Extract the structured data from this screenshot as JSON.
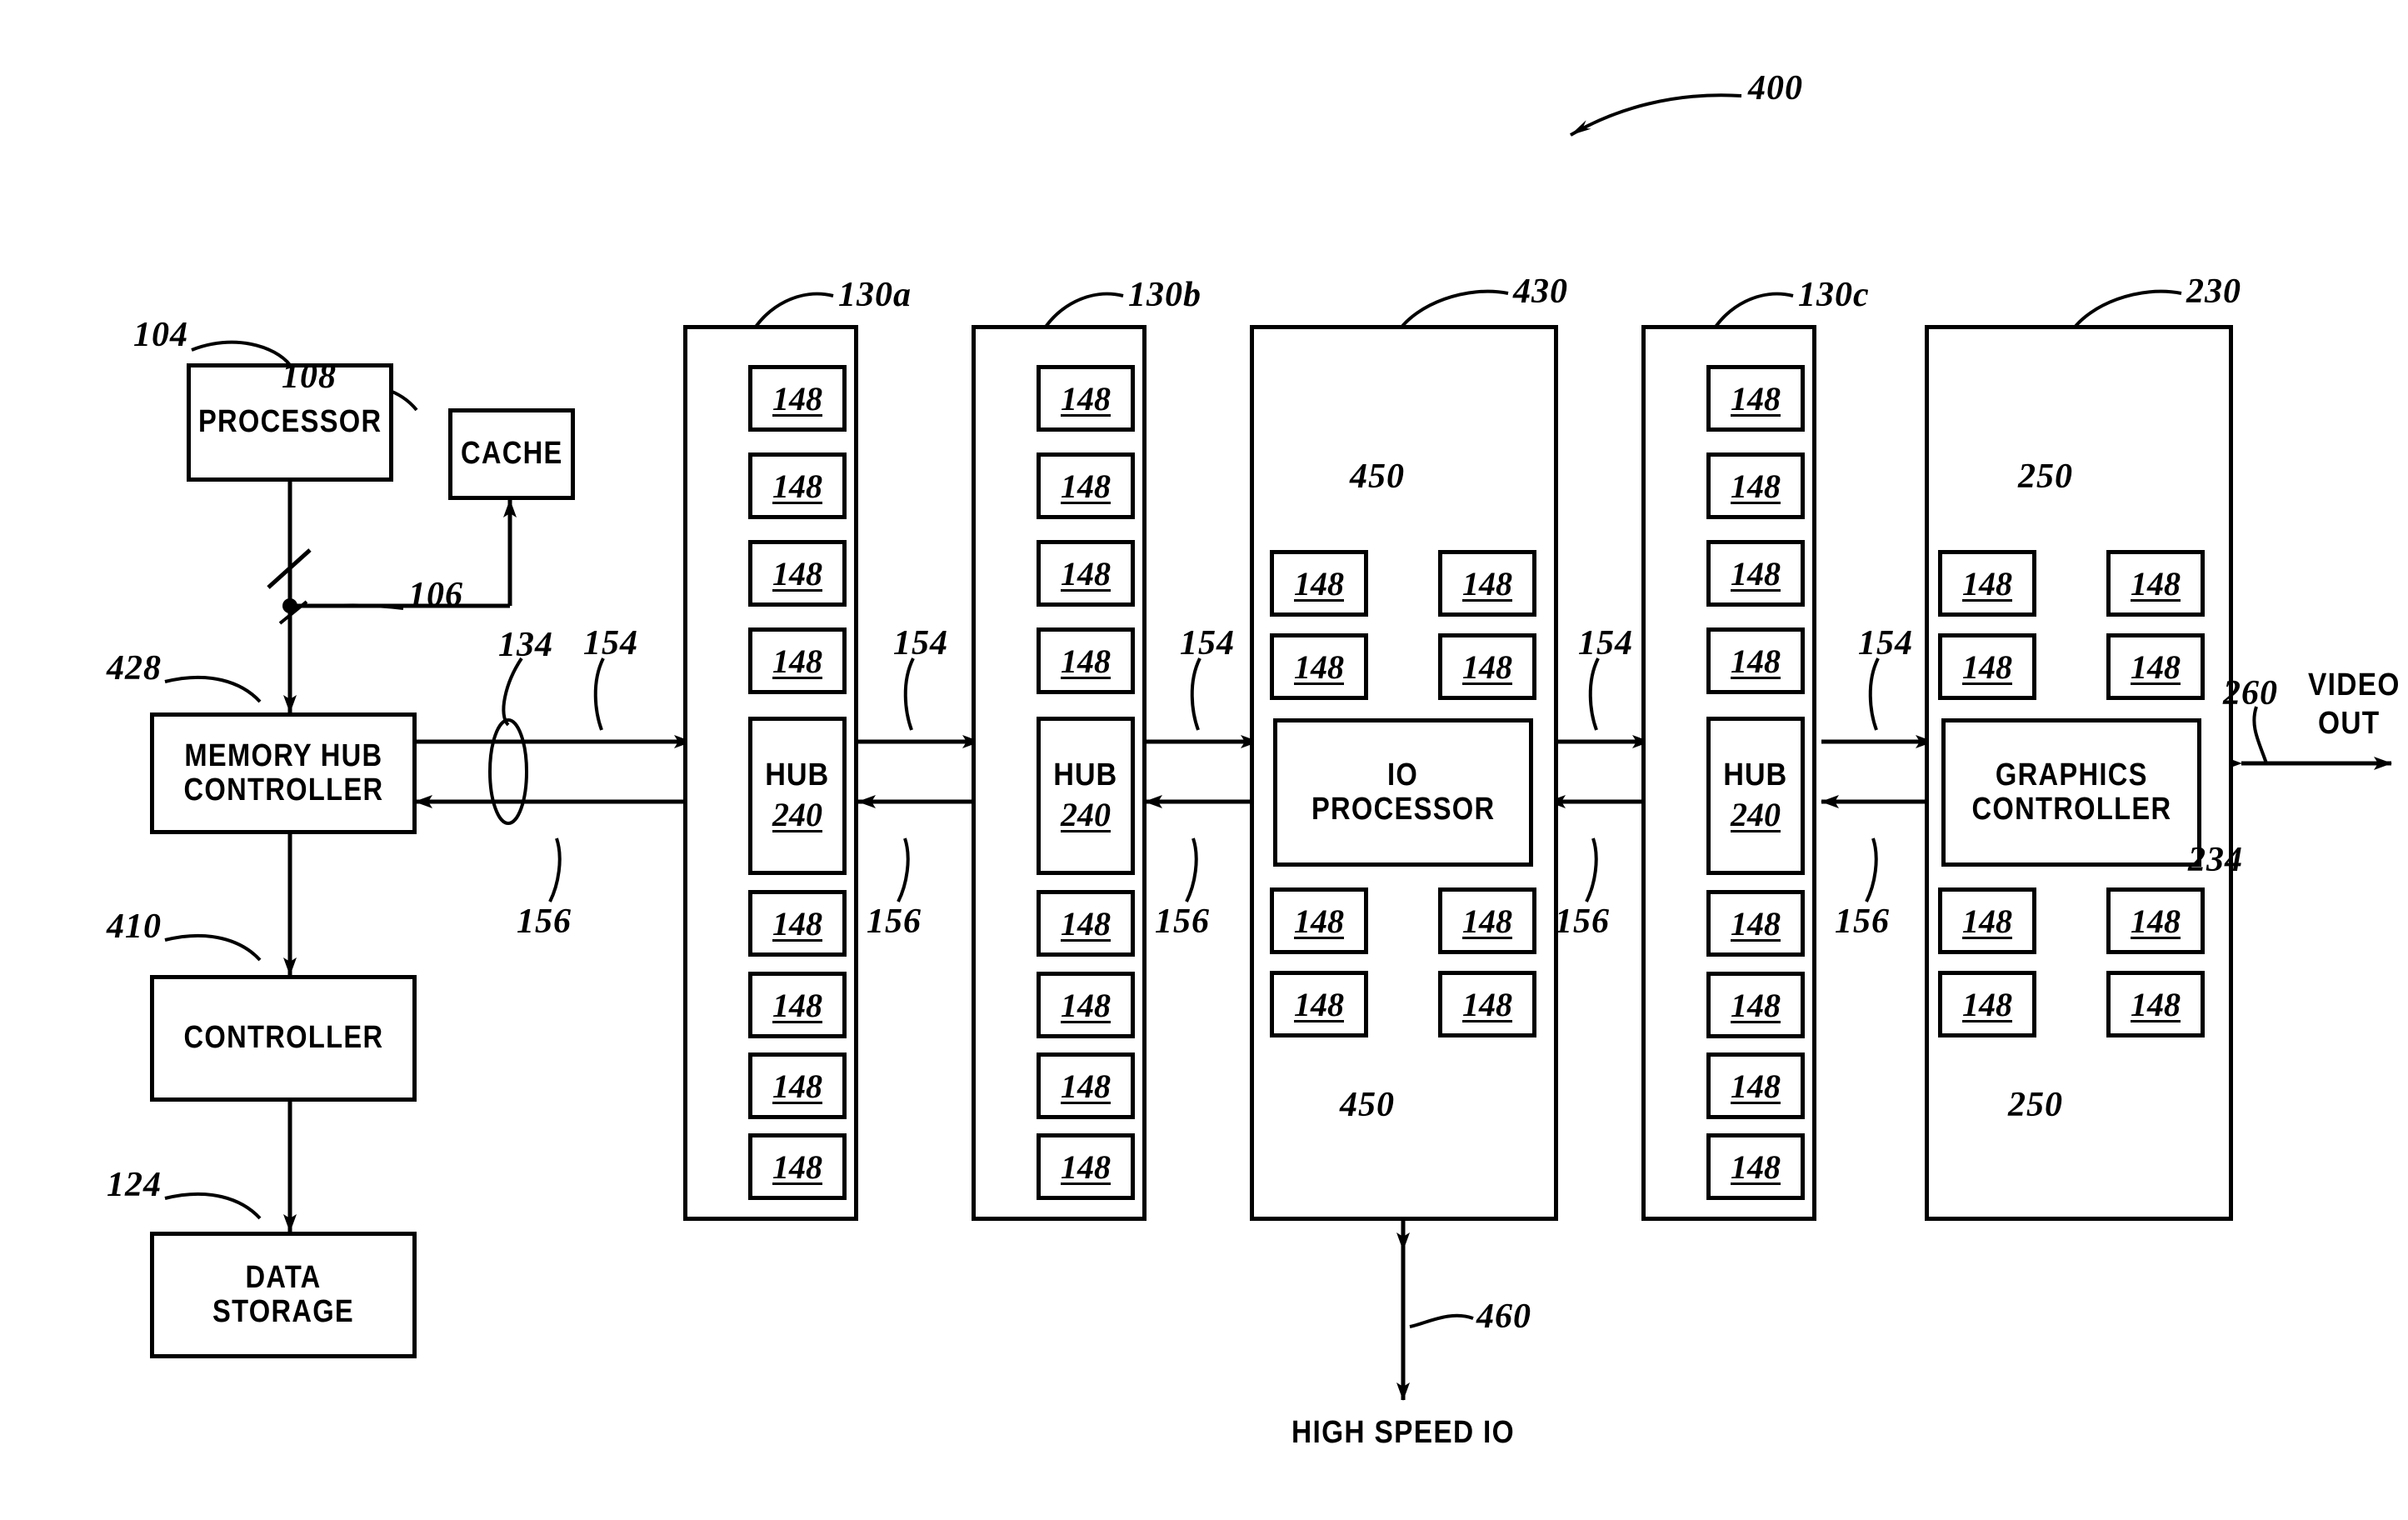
{
  "figure": {
    "id": "400",
    "type": "patent-block-diagram"
  },
  "blocks": {
    "processor": {
      "label": "PROCESSOR",
      "ref": "104"
    },
    "cache": {
      "label": "CACHE",
      "ref": "108"
    },
    "memory_hub_controller": {
      "label_line1": "MEMORY HUB",
      "label_line2": "CONTROLLER",
      "ref": "428"
    },
    "controller": {
      "label": "CONTROLLER",
      "ref": "410"
    },
    "data_storage": {
      "label": "DATA STORAGE",
      "ref": "124"
    },
    "io_processor": {
      "label_line1": "IO",
      "label_line2": "PROCESSOR",
      "ref": "430"
    },
    "graphics_controller": {
      "label_line1": "GRAPHICS",
      "label_line2": "CONTROLLER",
      "ref": "230"
    }
  },
  "memory_modules": [
    {
      "ref": "130a",
      "hub_word": "HUB",
      "hub_num": "240",
      "devices_above": [
        "148",
        "148",
        "148",
        "148"
      ],
      "devices_below": [
        "148",
        "148",
        "148",
        "148"
      ]
    },
    {
      "ref": "130b",
      "hub_word": "HUB",
      "hub_num": "240",
      "devices_above": [
        "148",
        "148",
        "148",
        "148"
      ],
      "devices_below": [
        "148",
        "148",
        "148",
        "148"
      ]
    },
    {
      "ref": "130c",
      "hub_word": "HUB",
      "hub_num": "240",
      "devices_above": [
        "148",
        "148",
        "148",
        "148"
      ],
      "devices_below": [
        "148",
        "148",
        "148",
        "148"
      ]
    }
  ],
  "io_block": {
    "ref": "430",
    "bus_ref_top": "450",
    "bus_ref_bottom": "450",
    "devices_top": [
      "148",
      "148"
    ],
    "devices_bottom": [
      "148",
      "148"
    ]
  },
  "graphics_block": {
    "ref": "230",
    "bus_ref_top": "250",
    "bus_ref_bottom": "250",
    "port_ref": "234",
    "devices_top": [
      "148",
      "148"
    ],
    "devices_bottom": [
      "148",
      "148"
    ]
  },
  "links": {
    "processor_bus_ref": "106",
    "hub_bus_ref": "134",
    "downstream_ref": "154",
    "upstream_ref": "156",
    "video_out_ref": "260",
    "video_out_label_line1": "VIDEO",
    "video_out_label_line2": "OUT",
    "high_speed_io_ref": "460",
    "high_speed_io_label": "HIGH SPEED IO"
  },
  "ref_numerals": {
    "fig": "400",
    "r104": "104",
    "r108": "108",
    "r106": "106",
    "r428": "428",
    "r410": "410",
    "r124": "124",
    "r134": "134",
    "r130a": "130a",
    "r130b": "130b",
    "r130c": "130c",
    "r430": "430",
    "r230": "230",
    "r234": "234",
    "r260": "260",
    "r450a": "450",
    "r450b": "450",
    "r250a": "250",
    "r250b": "250",
    "r460": "460",
    "r154_1": "154",
    "r154_2": "154",
    "r154_3": "154",
    "r154_4": "154",
    "r154_5": "154",
    "r156_1": "156",
    "r156_2": "156",
    "r156_3": "156",
    "r156_4": "156",
    "r156_5": "156"
  },
  "colors": {
    "ink": "#000000",
    "paper": "#ffffff"
  }
}
